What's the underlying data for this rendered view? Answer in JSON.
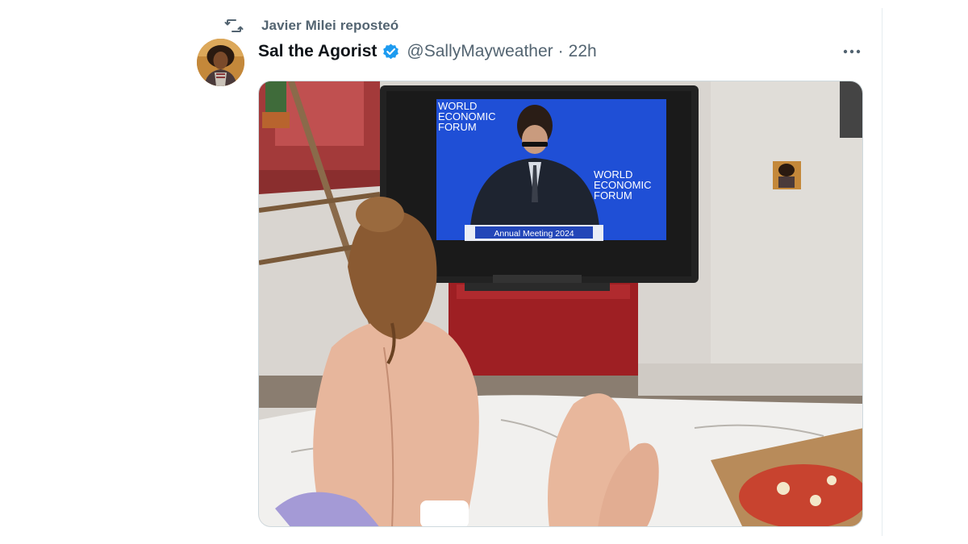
{
  "tweet": {
    "social_context": "Javier Milei reposteó",
    "author": {
      "display_name": "Sal the Agorist",
      "handle": "@SallyMayweather",
      "verified": true
    },
    "separator": "·",
    "timestamp": "22h",
    "media": {
      "tv_screen": {
        "brand_lines_left": [
          "WORLD",
          "ECONOMIC",
          "FORUM"
        ],
        "brand_lines_right": [
          "WORLD",
          "ECONOMIC",
          "FORUM"
        ],
        "podium_text": "Annual Meeting 2024"
      }
    }
  },
  "icons": {
    "repost": "repost-icon",
    "verified": "verified-badge-icon",
    "more": "more-options-icon"
  },
  "colors": {
    "secondary_text": "#536471",
    "verified_blue": "#1d9bf0",
    "wef_blue": "#1f4fd6"
  }
}
